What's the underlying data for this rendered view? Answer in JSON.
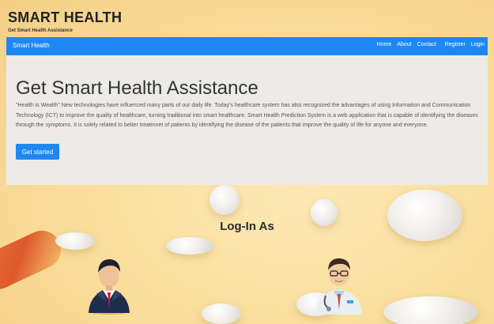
{
  "header": {
    "title": "SMART HEALTH",
    "subtitle": "Get Smart Health Assistance"
  },
  "navbar": {
    "brand": "Smart Health",
    "links": [
      "Home",
      "About",
      "Contact",
      "Register",
      "Login"
    ]
  },
  "hero": {
    "title": "Get Smart Health Assistance",
    "text": "\"Health is Wealth\" New technologies have influenced many parts of our daily life. Today's healthcare system has also recognized the advantages of using Information and Communication Technology (ICT) to improve the quality of healthcare, turning traditional into smart healthcare. Smart Health Prediction System is a web application that is capable of identifying the diseases through the symptoms. It is solely related to better treatmnet of patients by identifying the disease of the patients that improve the quality of life for anyone and everyone.",
    "button": "Get started"
  },
  "login": {
    "heading": "Log-In As",
    "options": [
      {
        "icon": "admin-user-icon"
      },
      {
        "icon": "doctor-icon"
      }
    ]
  },
  "colors": {
    "navbar": "#1e88f2",
    "button": "#1e88f2",
    "background": "#fbe3a8"
  }
}
